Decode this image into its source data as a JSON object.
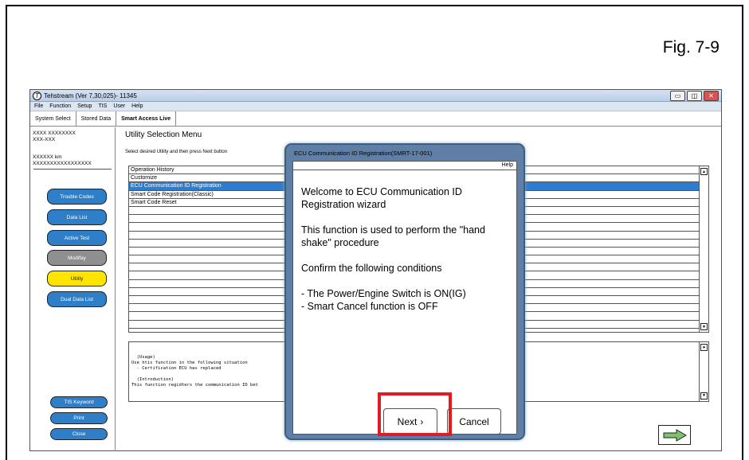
{
  "figure_label": "Fig. 7-9",
  "window": {
    "logo": "T",
    "title": "Tehstream (Ver 7,30,025)- 11345",
    "controls": [
      "▭",
      "◫",
      "✕"
    ]
  },
  "menu": [
    "File",
    "Function",
    "Setup",
    "TIS",
    "User",
    "Help"
  ],
  "tabs": [
    "System Select",
    "Stored Data",
    "Smart Access Live"
  ],
  "sidebar": {
    "vehicle_line1": "XXXX XXXXXXXX",
    "vehicle_line2": "XXX-XXX",
    "odometer": "XXXXXX km",
    "vin": "XXXXXXXXXXXXXXXXX",
    "buttons": [
      "Trouble Codes",
      "Data List",
      "Active Test",
      "Modifay",
      "Utility",
      "Dual Data List"
    ],
    "bottom_buttons": [
      "TIS Keyword",
      "Print",
      "Close"
    ]
  },
  "main": {
    "title": "Utility Selection Menu",
    "subtitle": "Select desired Utility and then press Next  button",
    "items": [
      "Operation History",
      "Customize",
      "ECU Communication ID Registration",
      "Smart Code Registration(Classic)",
      "Smart Code Reset",
      "",
      "",
      "",
      "",
      "",
      "",
      "",
      "",
      "",
      "",
      "",
      "",
      "",
      "",
      ""
    ],
    "selected_index": 2,
    "usage_text": "  (Usage)\nUse htis function in the following situation\n  - Certification ECU has replaced\n\n  (Introduction)\nThis function regidters the communication ID bet"
  },
  "dialog": {
    "title": "ECU Communication ID Registration(SMRT-17-001)",
    "help": "Help",
    "welcome": "Welcome to ECU Communication ID Registration wizard",
    "description": "This function is used to perform the \"hand shake\" procedure",
    "confirm": "Confirm the following conditions",
    "condition1": "- The Power/Engine Switch is ON(IG)",
    "condition2": "- Smart Cancel function is OFF",
    "next_label": "Next",
    "next_glyph": "›",
    "cancel_label": "Cancel"
  },
  "highlight_color": "#e21b23",
  "accent_color": "#2c7dd1"
}
